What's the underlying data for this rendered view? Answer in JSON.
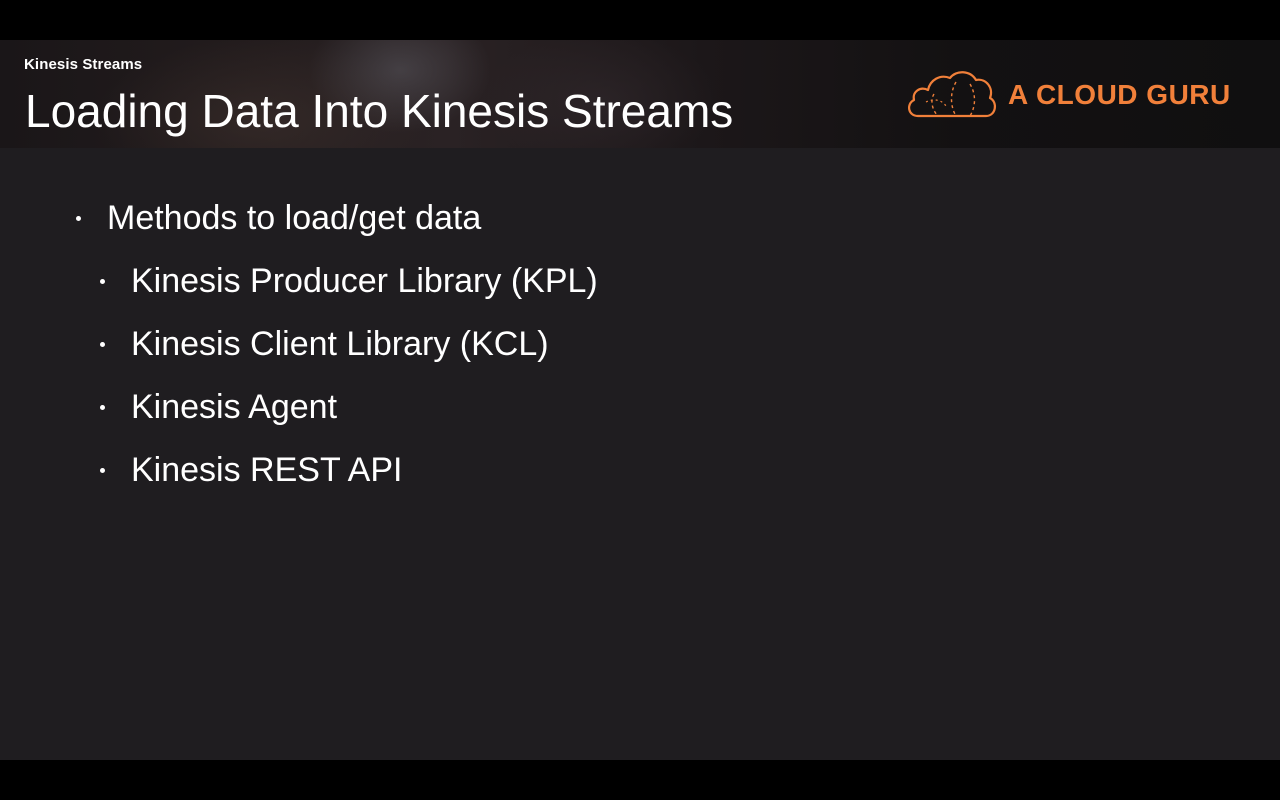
{
  "header": {
    "section_label": "Kinesis Streams",
    "title": "Loading Data Into Kinesis Streams"
  },
  "logo": {
    "text": "A CLOUD GURU",
    "icon": "cloud-icon",
    "color": "#f1803a"
  },
  "content": {
    "bullets": [
      {
        "level": 1,
        "text": "Methods to load/get data"
      },
      {
        "level": 2,
        "text": "Kinesis Producer Library (KPL)"
      },
      {
        "level": 2,
        "text": "Kinesis Client Library (KCL)"
      },
      {
        "level": 2,
        "text": "Kinesis Agent"
      },
      {
        "level": 2,
        "text": "Kinesis REST API"
      }
    ]
  },
  "colors": {
    "background": "#1f1d20",
    "text": "#ffffff",
    "accent": "#f1803a"
  }
}
